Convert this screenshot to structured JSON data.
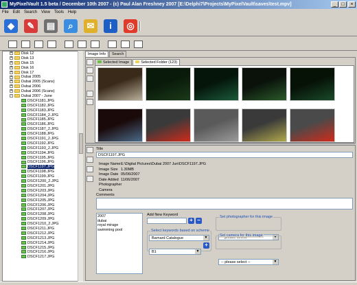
{
  "window": {
    "title": "MyPixelVault 1.5 beta / December 10th 2007 - (c) Paul Alan Freshney 2007    [E:\\Delphi7\\Projects\\MyPixelVault\\saves\\test.mpv]"
  },
  "menu": [
    "File",
    "Edit",
    "Search",
    "View",
    "Tools",
    "Help"
  ],
  "toolbar1": [
    {
      "icon": "vault-icon",
      "color": "#2a6fd6",
      "glyph": "◆"
    },
    {
      "icon": "eraser-icon",
      "color": "#d93b3b",
      "glyph": "✎"
    },
    {
      "icon": "print-icon",
      "color": "#707070",
      "glyph": "▤"
    },
    {
      "icon": "magnifier-icon",
      "color": "#3a8de0",
      "glyph": "⌕"
    },
    {
      "icon": "folder-edit-icon",
      "color": "#e0b02a",
      "glyph": "✉"
    },
    {
      "icon": "info-icon",
      "color": "#1d5fc4",
      "glyph": "i"
    },
    {
      "icon": "lifebuoy-icon",
      "color": "#e03a2a",
      "glyph": "◎"
    }
  ],
  "toolbar2_count": 10,
  "tree": [
    {
      "type": "folder",
      "label": "Disk 12",
      "expander": "+"
    },
    {
      "type": "folder",
      "label": "Disk 13",
      "expander": "+"
    },
    {
      "type": "folder",
      "label": "Disk 15",
      "expander": "+"
    },
    {
      "type": "folder",
      "label": "Disk 16",
      "expander": "+"
    },
    {
      "type": "folder",
      "label": "Disk 17",
      "expander": "+"
    },
    {
      "type": "folder",
      "label": "Dubai 2005",
      "expander": "+"
    },
    {
      "type": "folder",
      "label": "Dubai 2005 (Scans)",
      "expander": "+"
    },
    {
      "type": "folder",
      "label": "Dubai 2006",
      "expander": "+"
    },
    {
      "type": "folder",
      "label": "Dubai 2006 (Scans)",
      "expander": "+"
    },
    {
      "type": "folder",
      "label": "Dubai 2007 - June",
      "expander": "-"
    },
    {
      "type": "file",
      "label": "DSCF1181.JPG"
    },
    {
      "type": "file",
      "label": "DSCF1182.JPG"
    },
    {
      "type": "file",
      "label": "DSCF1183.JPG"
    },
    {
      "type": "file",
      "label": "DSCF1184_2.JPG"
    },
    {
      "type": "file",
      "label": "DSCF1185.JPG"
    },
    {
      "type": "file",
      "label": "DSCF1186.JPG"
    },
    {
      "type": "file",
      "label": "DSCF1187_2.JPG"
    },
    {
      "type": "file",
      "label": "DSCF1188.JPG"
    },
    {
      "type": "file",
      "label": "DSCF1191_2.JPG"
    },
    {
      "type": "file",
      "label": "DSCF1192.JPG"
    },
    {
      "type": "file",
      "label": "DSCF1193_2.JPG"
    },
    {
      "type": "file",
      "label": "DSCF1194.JPG"
    },
    {
      "type": "file",
      "label": "DSCF1195.JPG"
    },
    {
      "type": "file",
      "label": "DSCF1196.JPG"
    },
    {
      "type": "file",
      "label": "DSCF1197.JPG",
      "selected": true
    },
    {
      "type": "file",
      "label": "DSCF1198.JPG"
    },
    {
      "type": "file",
      "label": "DSCF1199.JPG"
    },
    {
      "type": "file",
      "label": "DSCF1200_2.JPG"
    },
    {
      "type": "file",
      "label": "DSCF1201.JPG"
    },
    {
      "type": "file",
      "label": "DSCF1203.JPG"
    },
    {
      "type": "file",
      "label": "DSCF1204.JPG"
    },
    {
      "type": "file",
      "label": "DSCF1205.JPG"
    },
    {
      "type": "file",
      "label": "DSCF1206.JPG"
    },
    {
      "type": "file",
      "label": "DSCF1207.JPG"
    },
    {
      "type": "file",
      "label": "DSCF1208.JPG"
    },
    {
      "type": "file",
      "label": "DSCF1209.JPG"
    },
    {
      "type": "file",
      "label": "DSCF1210_2.JPG"
    },
    {
      "type": "file",
      "label": "DSCF1211.JPG"
    },
    {
      "type": "file",
      "label": "DSCF1212.JPG"
    },
    {
      "type": "file",
      "label": "DSCF1213.JPG"
    },
    {
      "type": "file",
      "label": "DSCF1214.JPG"
    },
    {
      "type": "file",
      "label": "DSCF1215.JPG"
    },
    {
      "type": "file",
      "label": "DSCF1216.JPG"
    },
    {
      "type": "file",
      "label": "DSCF1217.JPG"
    }
  ],
  "tabs": {
    "top": [
      "Image Info",
      "Search"
    ],
    "sub": [
      "Selected Image",
      "Selected Folder (123)"
    ]
  },
  "thumbnails": [
    {
      "colors": [
        "#3a2a1a",
        "#b9b09a"
      ]
    },
    {
      "colors": [
        "#0a1a0a",
        "#1a3a1a"
      ]
    },
    {
      "colors": [
        "#05150a",
        "#1a5a3a"
      ]
    },
    {
      "colors": [
        "#0a120a",
        "#2a5a2a"
      ]
    },
    {
      "colors": [
        "#061206",
        "#1a4a2a"
      ]
    },
    {
      "colors": [
        "#1a0a0a",
        "#4a6a8a"
      ]
    },
    {
      "colors": [
        "#3a3a3a",
        "#d02a1a"
      ]
    },
    {
      "colors": [
        "#5a5a5a",
        "#9a9a9a"
      ]
    },
    {
      "colors": [
        "#3a3a3a",
        "#b0a84a"
      ]
    },
    {
      "colors": [
        "#4a4a4a",
        "#d02a1a"
      ]
    }
  ],
  "details": {
    "title_label": "Title",
    "title_value": "DSCF1197.JPG",
    "rows": [
      {
        "label": "Image Name",
        "value": "E:\\Digital Pictures\\Dubai 2007 Jun\\DSCF1197.JPG"
      },
      {
        "label": "Image Size",
        "value": "1.30MB"
      },
      {
        "label": "Image Date",
        "value": "05/06/2007"
      },
      {
        "label": "Date Added",
        "value": "11/06/2007"
      },
      {
        "label": "Photographer",
        "value": ""
      },
      {
        "label": "Camera",
        "value": ""
      }
    ],
    "comments_label": "Comments"
  },
  "keywords": [
    "2007",
    "dubai",
    "royal mirage",
    "swimming pool"
  ],
  "keyword_panel": {
    "add_label": "Add New Keyword",
    "scheme_title": "Select keywords based on scheme",
    "scheme_value": "Barnard Catalogue",
    "sub_value": "B1"
  },
  "photographer": {
    "title": "Set photographer for this image",
    "value": "-- please select --"
  },
  "camera": {
    "title": "Set camera for this image",
    "value": "-- please select --"
  }
}
